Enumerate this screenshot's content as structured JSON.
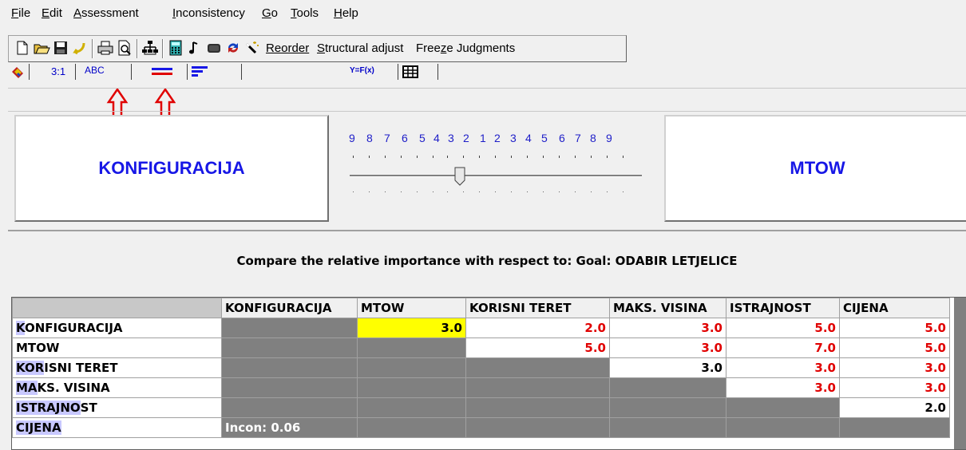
{
  "menu": [
    {
      "acc": "F",
      "rest": "ile"
    },
    {
      "acc": "E",
      "rest": "dit"
    },
    {
      "acc": "A",
      "rest": "ssessment"
    },
    {
      "acc": "I",
      "rest": "nconsistency"
    },
    {
      "acc": "G",
      "rest": "o"
    },
    {
      "acc": "T",
      "rest": "ools"
    },
    {
      "acc": "H",
      "rest": "elp"
    }
  ],
  "toolbar": {
    "reorder": "Reorder",
    "structural_acc": "S",
    "structural_rest": "tructural adjust",
    "freeze_pre": "Free",
    "freeze_acc": "z",
    "freeze_rest": "e Judgments"
  },
  "tabs": {
    "ratio": "3:1",
    "verbal": "ABC",
    "yfx": "Y=F(x)"
  },
  "compare": {
    "left": "KONFIGURACIJA",
    "right": "MTOW",
    "scale": [
      "9",
      "8",
      "7",
      "6",
      "5",
      "4",
      "3",
      "2",
      "1",
      "2",
      "3",
      "4",
      "5",
      "6",
      "7",
      "8",
      "9"
    ],
    "prompt": "Compare the relative importance  with respect to: Goal: ODABIR LETJELICE"
  },
  "matrix": {
    "columns": [
      "KONFIGURACIJA",
      "MTOW",
      "KORISNI TERET",
      "MAKS. VISINA",
      "ISTRAJNOST",
      "CIJENA"
    ],
    "rows": [
      {
        "hl": "K",
        "rest": "ONFIGURACIJA",
        "cells": [
          "",
          "3.0",
          "2.0",
          "3.0",
          "5.0",
          "5.0"
        ]
      },
      {
        "hl": "",
        "rest": "MTOW",
        "cells": [
          "",
          "",
          "5.0",
          "3.0",
          "7.0",
          "5.0"
        ]
      },
      {
        "hl": "KOR",
        "rest": "ISNI TERET",
        "cells": [
          "",
          "",
          "",
          "3.0",
          "3.0",
          "3.0"
        ]
      },
      {
        "hl": "MA",
        "rest": "KS. VISINA",
        "cells": [
          "",
          "",
          "",
          "",
          "3.0",
          "3.0"
        ]
      },
      {
        "hl": "ISTRAJNO",
        "rest": "ST",
        "cells": [
          "",
          "",
          "",
          "",
          "",
          "2.0"
        ]
      },
      {
        "hl": "CIJENA",
        "rest": "",
        "cells": [
          "",
          "",
          "",
          "",
          "",
          ""
        ]
      }
    ],
    "incon": "Incon: 0.06"
  },
  "colors": {
    "accent_blue": "#1717e6",
    "value_red": "#e00000",
    "selected_yellow": "#ffff00",
    "gray_cell": "#808080",
    "row_highlight": "#c8c8ff"
  }
}
